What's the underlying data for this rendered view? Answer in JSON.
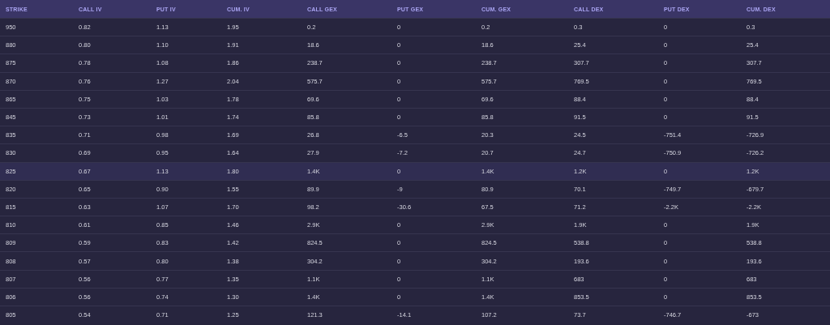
{
  "table": {
    "columns": [
      "STRIKE",
      "CALL IV",
      "PUT IV",
      "CUM. IV",
      "CALL GEX",
      "PUT GEX",
      "CUM. GEX",
      "CALL DEX",
      "PUT DEX",
      "CUM. DEX"
    ],
    "rows": [
      {
        "highlighted": false,
        "cells": [
          "950",
          "0.82",
          "1.13",
          "1.95",
          "0.2",
          "0",
          "0.2",
          "0.3",
          "0",
          "0.3"
        ]
      },
      {
        "highlighted": false,
        "cells": [
          "880",
          "0.80",
          "1.10",
          "1.91",
          "18.6",
          "0",
          "18.6",
          "25.4",
          "0",
          "25.4"
        ]
      },
      {
        "highlighted": false,
        "cells": [
          "875",
          "0.78",
          "1.08",
          "1.86",
          "238.7",
          "0",
          "238.7",
          "307.7",
          "0",
          "307.7"
        ]
      },
      {
        "highlighted": false,
        "cells": [
          "870",
          "0.76",
          "1.27",
          "2.04",
          "575.7",
          "0",
          "575.7",
          "769.5",
          "0",
          "769.5"
        ]
      },
      {
        "highlighted": false,
        "cells": [
          "865",
          "0.75",
          "1.03",
          "1.78",
          "69.6",
          "0",
          "69.6",
          "88.4",
          "0",
          "88.4"
        ]
      },
      {
        "highlighted": false,
        "cells": [
          "845",
          "0.73",
          "1.01",
          "1.74",
          "85.8",
          "0",
          "85.8",
          "91.5",
          "0",
          "91.5"
        ]
      },
      {
        "highlighted": false,
        "cells": [
          "835",
          "0.71",
          "0.98",
          "1.69",
          "26.8",
          "-6.5",
          "20.3",
          "24.5",
          "-751.4",
          "-726.9"
        ]
      },
      {
        "highlighted": false,
        "cells": [
          "830",
          "0.69",
          "0.95",
          "1.64",
          "27.9",
          "-7.2",
          "20.7",
          "24.7",
          "-750.9",
          "-726.2"
        ]
      },
      {
        "highlighted": true,
        "cells": [
          "825",
          "0.67",
          "1.13",
          "1.80",
          "1.4K",
          "0",
          "1.4K",
          "1.2K",
          "0",
          "1.2K"
        ]
      },
      {
        "highlighted": false,
        "cells": [
          "820",
          "0.65",
          "0.90",
          "1.55",
          "89.9",
          "-9",
          "80.9",
          "70.1",
          "-749.7",
          "-679.7"
        ]
      },
      {
        "highlighted": false,
        "cells": [
          "815",
          "0.63",
          "1.07",
          "1.70",
          "98.2",
          "-30.6",
          "67.5",
          "71.2",
          "-2.2K",
          "-2.2K"
        ]
      },
      {
        "highlighted": false,
        "cells": [
          "810",
          "0.61",
          "0.85",
          "1.46",
          "2.9K",
          "0",
          "2.9K",
          "1.9K",
          "0",
          "1.9K"
        ]
      },
      {
        "highlighted": false,
        "cells": [
          "809",
          "0.59",
          "0.83",
          "1.42",
          "824.5",
          "0",
          "824.5",
          "538.8",
          "0",
          "538.8"
        ]
      },
      {
        "highlighted": false,
        "cells": [
          "808",
          "0.57",
          "0.80",
          "1.38",
          "304.2",
          "0",
          "304.2",
          "193.6",
          "0",
          "193.6"
        ]
      },
      {
        "highlighted": false,
        "cells": [
          "807",
          "0.56",
          "0.77",
          "1.35",
          "1.1K",
          "0",
          "1.1K",
          "683",
          "0",
          "683"
        ]
      },
      {
        "highlighted": false,
        "cells": [
          "806",
          "0.56",
          "0.74",
          "1.30",
          "1.4K",
          "0",
          "1.4K",
          "853.5",
          "0",
          "853.5"
        ]
      },
      {
        "highlighted": false,
        "cells": [
          "805",
          "0.54",
          "0.71",
          "1.25",
          "121.3",
          "-14.1",
          "107.2",
          "73.7",
          "-746.7",
          "-673"
        ]
      }
    ]
  }
}
